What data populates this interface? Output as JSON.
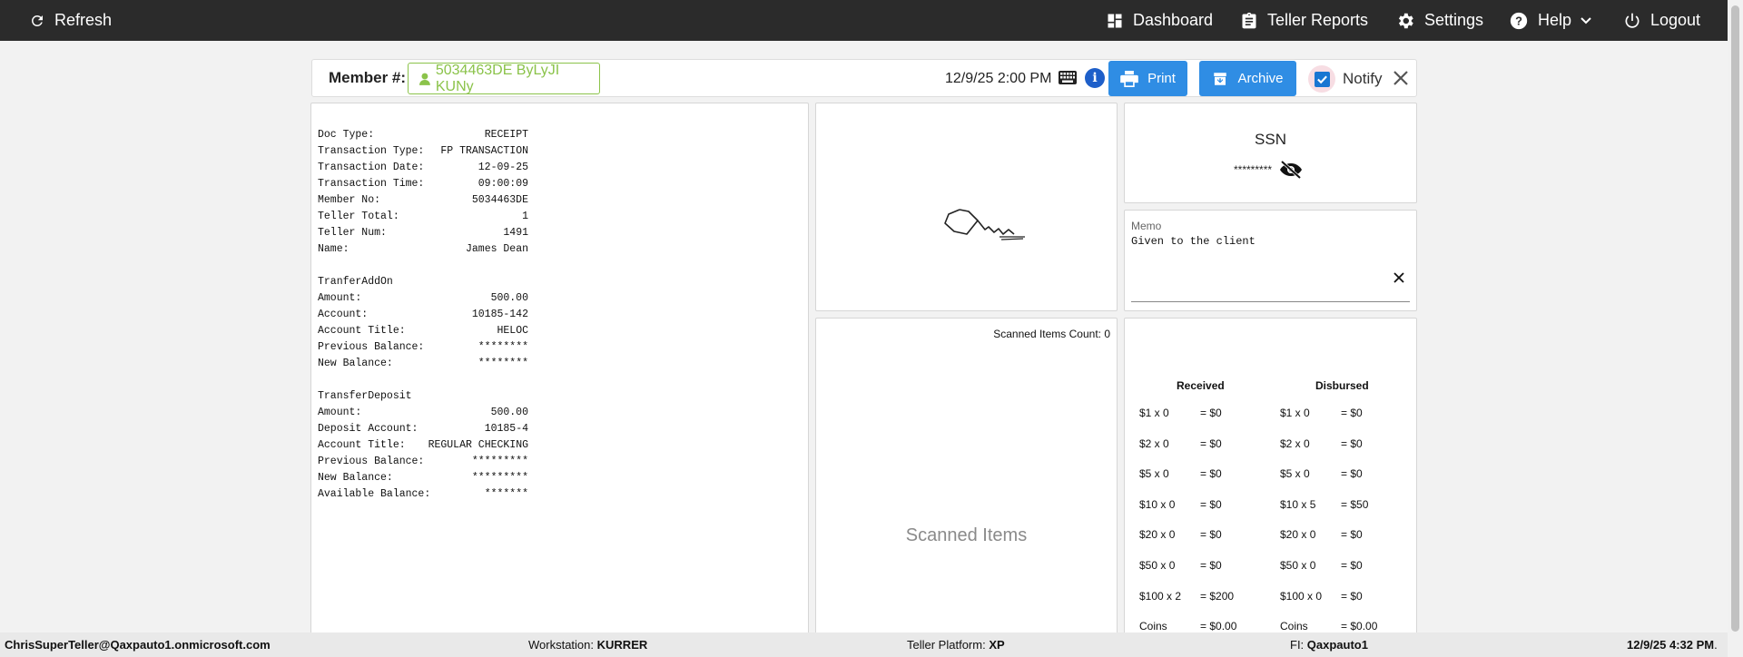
{
  "topbar": {
    "refresh_label": "Refresh",
    "nav": {
      "dashboard": "Dashboard",
      "teller_reports": "Teller Reports",
      "settings": "Settings",
      "help": "Help",
      "logout": "Logout"
    }
  },
  "member_bar": {
    "label": "Member #:",
    "member_value": "5034463DE ByLyJI KUNy",
    "datetime": "12/9/25 2:00 PM",
    "print_label": "Print",
    "archive_label": "Archive",
    "notify_label": "Notify",
    "notify_checked": true
  },
  "receipt": {
    "rows": [
      {
        "label": "Doc Type:",
        "value": "RECEIPT"
      },
      {
        "label": "Transaction Type:",
        "value": "FP TRANSACTION"
      },
      {
        "label": "Transaction Date:",
        "value": "12-09-25"
      },
      {
        "label": "Transaction Time:",
        "value": "09:00:09"
      },
      {
        "label": "Member No:",
        "value": "5034463DE"
      },
      {
        "label": "Teller Total:",
        "value": "1"
      },
      {
        "label": "Teller Num:",
        "value": "1491"
      },
      {
        "label": "Name:",
        "value": "James Dean"
      }
    ],
    "section1_title": "TranferAddOn",
    "section1": [
      {
        "label": "Amount:",
        "value": "500.00"
      },
      {
        "label": "Account:",
        "value": "10185-142"
      },
      {
        "label": "Account Title:",
        "value": "HELOC"
      },
      {
        "label": "Previous Balance:",
        "value": "********"
      },
      {
        "label": "New Balance:",
        "value": "********"
      }
    ],
    "section2_title": "TransferDeposit",
    "section2": [
      {
        "label": "Amount:",
        "value": "500.00"
      },
      {
        "label": "Deposit Account:",
        "value": "10185-4"
      },
      {
        "label": "Account Title:",
        "value": "REGULAR CHECKING"
      },
      {
        "label": "Previous Balance:",
        "value": "*********"
      },
      {
        "label": "New Balance:",
        "value": "*********"
      },
      {
        "label": "Available Balance:",
        "value": "*******"
      }
    ]
  },
  "ssn": {
    "title": "SSN",
    "masked_value": "*********"
  },
  "memo": {
    "label": "Memo",
    "text": "Given to the client"
  },
  "scanned": {
    "count_text": "Scanned Items Count: 0",
    "title": "Scanned Items"
  },
  "cash": {
    "received_header": "Received",
    "disbursed_header": "Disbursed",
    "received": [
      {
        "denom": "$1 x 0",
        "total": "= $0"
      },
      {
        "denom": "$2 x 0",
        "total": "= $0"
      },
      {
        "denom": "$5 x 0",
        "total": "= $0"
      },
      {
        "denom": "$10 x 0",
        "total": "= $0"
      },
      {
        "denom": "$20 x 0",
        "total": "= $0"
      },
      {
        "denom": "$50 x 0",
        "total": "= $0"
      },
      {
        "denom": "$100 x 2",
        "total": "= $200"
      },
      {
        "denom": "Coins",
        "total": "= $0.00"
      }
    ],
    "disbursed": [
      {
        "denom": "$1 x 0",
        "total": "= $0"
      },
      {
        "denom": "$2 x 0",
        "total": "= $0"
      },
      {
        "denom": "$5 x 0",
        "total": "= $0"
      },
      {
        "denom": "$10 x 5",
        "total": "= $50"
      },
      {
        "denom": "$20 x 0",
        "total": "= $0"
      },
      {
        "denom": "$50 x 0",
        "total": "= $0"
      },
      {
        "denom": "$100 x 0",
        "total": "= $0"
      },
      {
        "denom": "Coins",
        "total": "= $0.00"
      }
    ]
  },
  "statusbar": {
    "user": "ChrisSuperTeller@Qaxpauto1.onmicrosoft.com",
    "workstation_label": "Workstation:",
    "workstation": "KURRER",
    "platform_label": "Teller Platform:",
    "platform": "XP",
    "fi_label": "FI:",
    "fi": "Qaxpauto1",
    "datetime": "12/9/25 4:32 PM",
    "datetime_suffix": "."
  },
  "colors": {
    "topbar_bg": "#2b2b2b",
    "button_blue": "#2f8de4",
    "member_green": "#8bc34a",
    "info_blue": "#1e5fc9"
  }
}
